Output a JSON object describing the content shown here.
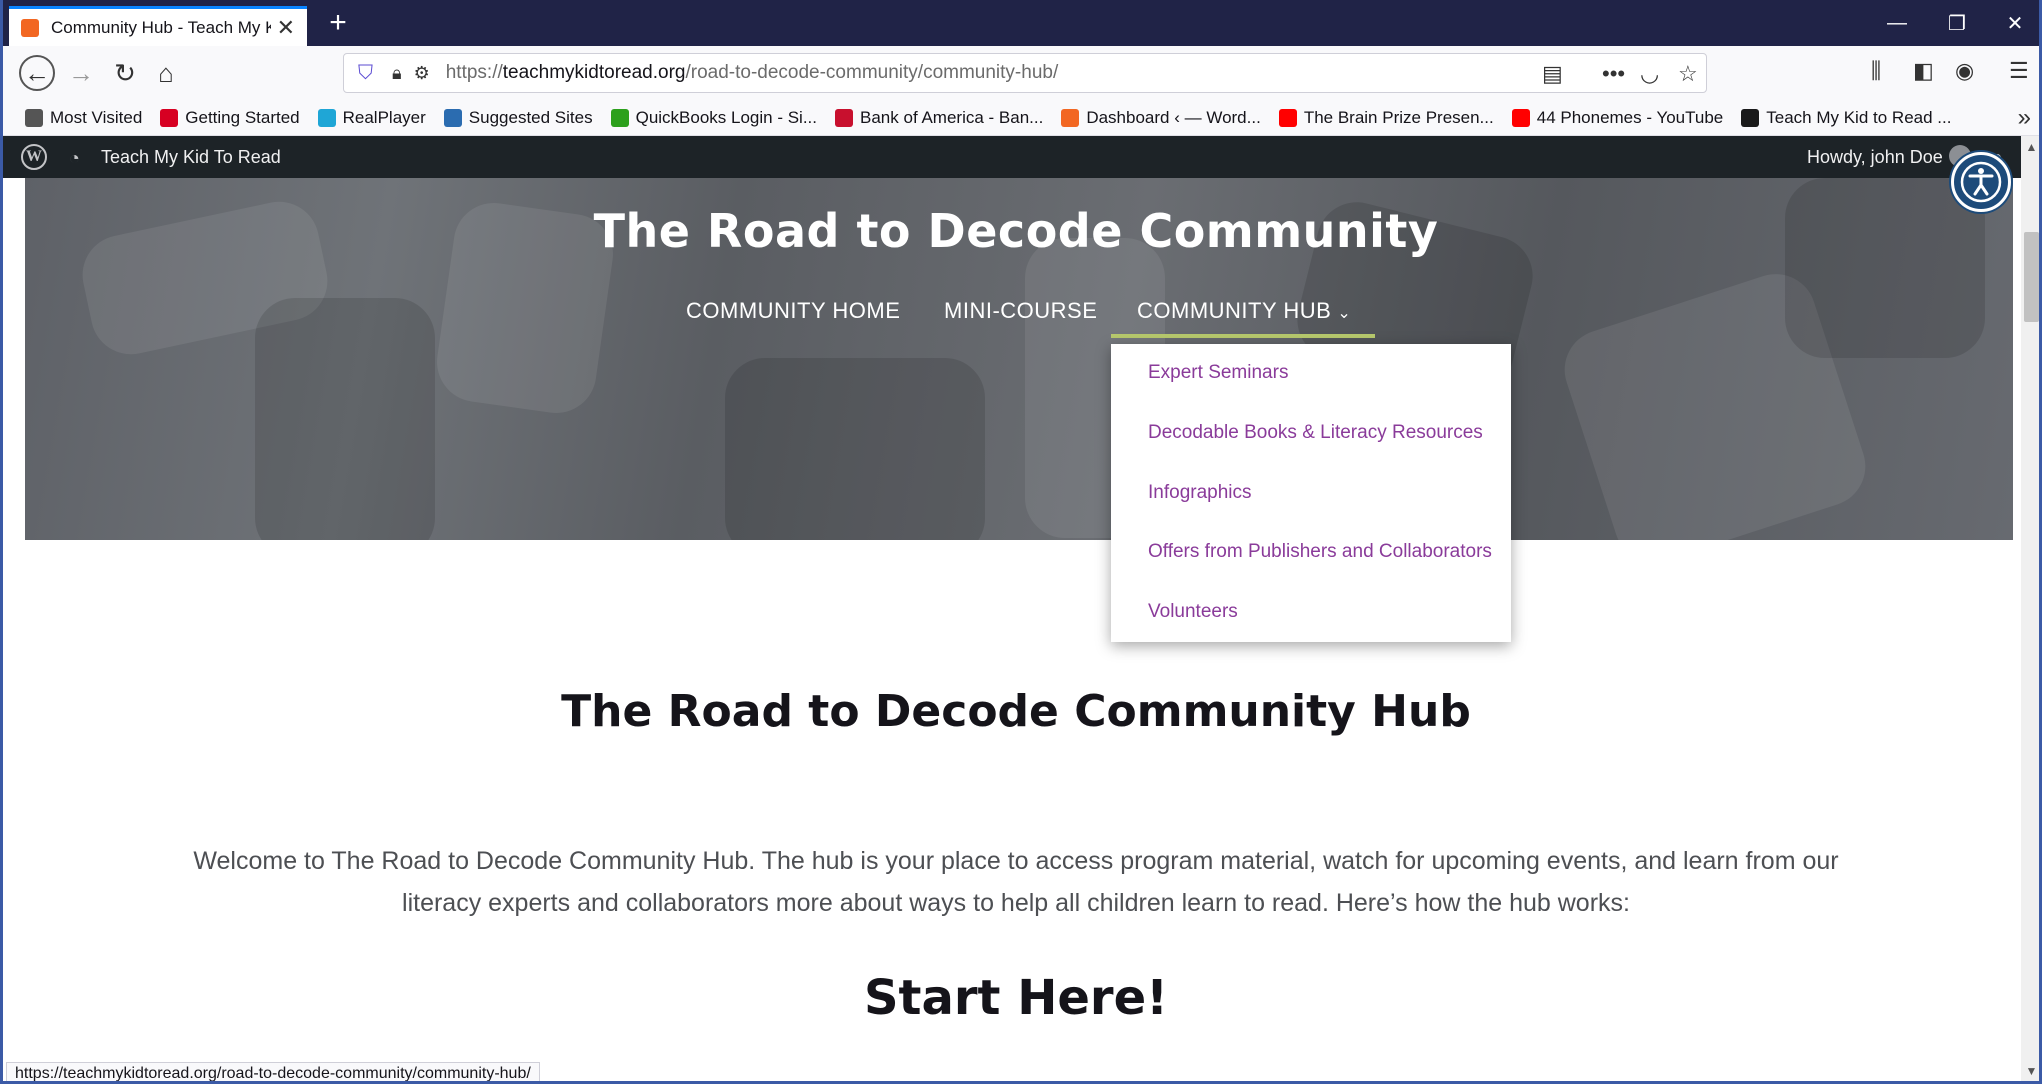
{
  "browser": {
    "tab_title": "Community Hub - Teach My Kid",
    "url_scheme": "https://",
    "url_host": "teachmykidtoread.org",
    "url_path": "/road-to-decode-community/community-hub/",
    "status_url": "https://teachmykidtoread.org/road-to-decode-community/community-hub/"
  },
  "bookmarks": [
    {
      "label": "Most Visited",
      "color": "#555555",
      "icon": "gear-icon"
    },
    {
      "label": "Getting Started",
      "color": "#d70022",
      "icon": "firefox-icon"
    },
    {
      "label": "RealPlayer",
      "color": "#1fa6d6",
      "icon": "realplayer-icon"
    },
    {
      "label": "Suggested Sites",
      "color": "#2b6cb0",
      "icon": "ie-icon"
    },
    {
      "label": "QuickBooks Login - Si...",
      "color": "#2ca01c",
      "icon": "quickbooks-icon"
    },
    {
      "label": "Bank of America - Ban...",
      "color": "#c8102e",
      "icon": "bofa-icon"
    },
    {
      "label": "Dashboard ‹ — Word...",
      "color": "#f26722",
      "icon": "site-icon"
    },
    {
      "label": "The Brain Prize Presen...",
      "color": "#ff0000",
      "icon": "youtube-icon"
    },
    {
      "label": "44 Phonemes - YouTube",
      "color": "#ff0000",
      "icon": "youtube-icon"
    },
    {
      "label": "Teach My Kid to Read ...",
      "color": "#1a1a1a",
      "icon": "site-icon"
    }
  ],
  "adminbar": {
    "site_name": "Teach My Kid To Read",
    "howdy": "Howdy, john Doe"
  },
  "site": {
    "title": "The Road to Decode Community",
    "nav": [
      {
        "label": "COMMUNITY HOME"
      },
      {
        "label": "MINI-COURSE"
      },
      {
        "label": "COMMUNITY HUB"
      }
    ],
    "dropdown": [
      {
        "label": "Expert Seminars"
      },
      {
        "label": "Decodable Books & Literacy Resources"
      },
      {
        "label": "Infographics"
      },
      {
        "label": "Offers from Publishers and Collaborators"
      },
      {
        "label": "Volunteers"
      }
    ]
  },
  "content": {
    "heading": "The Road to Decode Community Hub",
    "intro": "Welcome to The Road to Decode Community Hub. The hub is your place to access program material,  watch for upcoming events, and learn from our literacy experts and collaborators more about ways to help all children learn to read. Here’s how the hub works:",
    "subheading": "Start Here!"
  },
  "colors": {
    "link_purple": "#8a3b9a",
    "nav_underline": "#b7c96d",
    "tab_strip": "#202347",
    "admin_bar": "#1d2327"
  }
}
